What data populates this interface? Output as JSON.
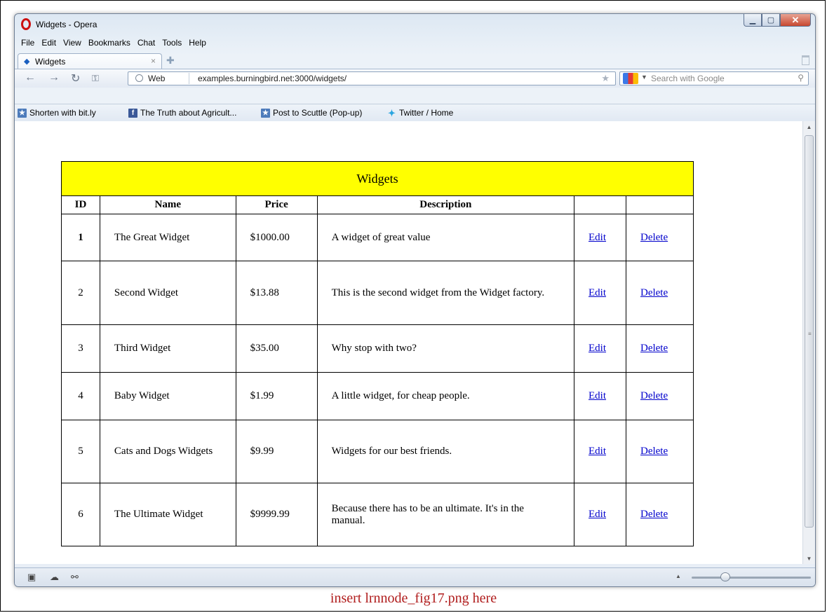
{
  "window": {
    "title": "Widgets - Opera"
  },
  "menu": [
    "File",
    "Edit",
    "View",
    "Bookmarks",
    "Chat",
    "Tools",
    "Help"
  ],
  "tab": {
    "label": "Widgets",
    "close": "×"
  },
  "address": {
    "badge": "Web",
    "url": "examples.burningbird.net:3000/widgets/"
  },
  "search": {
    "placeholder": "Search with Google"
  },
  "bookmarks": [
    {
      "label": "Shorten with bit.ly",
      "icon": "bookmark-icon"
    },
    {
      "label": "The Truth about Agricult...",
      "icon": "facebook-icon"
    },
    {
      "label": "Post to Scuttle (Pop-up)",
      "icon": "bookmark-icon"
    },
    {
      "label": "Twitter / Home",
      "icon": "twitter-icon"
    }
  ],
  "table": {
    "caption": "Widgets",
    "headers": [
      "ID",
      "Name",
      "Price",
      "Description",
      "",
      ""
    ],
    "rows": [
      {
        "id": "1",
        "name": "The Great Widget",
        "price": "$1000.00",
        "description": "A widget of great value",
        "edit": "Edit",
        "delete": "Delete"
      },
      {
        "id": "2",
        "name": "Second Widget",
        "price": "$13.88",
        "description": "This is the second widget from the Widget factory.",
        "edit": "Edit",
        "delete": "Delete"
      },
      {
        "id": "3",
        "name": "Third Widget",
        "price": "$35.00",
        "description": "Why stop with two?",
        "edit": "Edit",
        "delete": "Delete"
      },
      {
        "id": "4",
        "name": "Baby Widget",
        "price": "$1.99",
        "description": "A little widget, for cheap people.",
        "edit": "Edit",
        "delete": "Delete"
      },
      {
        "id": "5",
        "name": "Cats and Dogs Widgets",
        "price": "$9.99",
        "description": "Widgets for our best friends.",
        "edit": "Edit",
        "delete": "Delete"
      },
      {
        "id": "6",
        "name": "The Ultimate Widget",
        "price": "$9999.99",
        "description": "Because there has to be an ultimate. It's in the manual.",
        "edit": "Edit",
        "delete": "Delete"
      }
    ]
  },
  "caption": "insert lrnnode_fig17.png here",
  "colors": {
    "table_caption_bg": "#ffff00",
    "link": "#0000cc",
    "figure_caption": "#b01c1c"
  }
}
